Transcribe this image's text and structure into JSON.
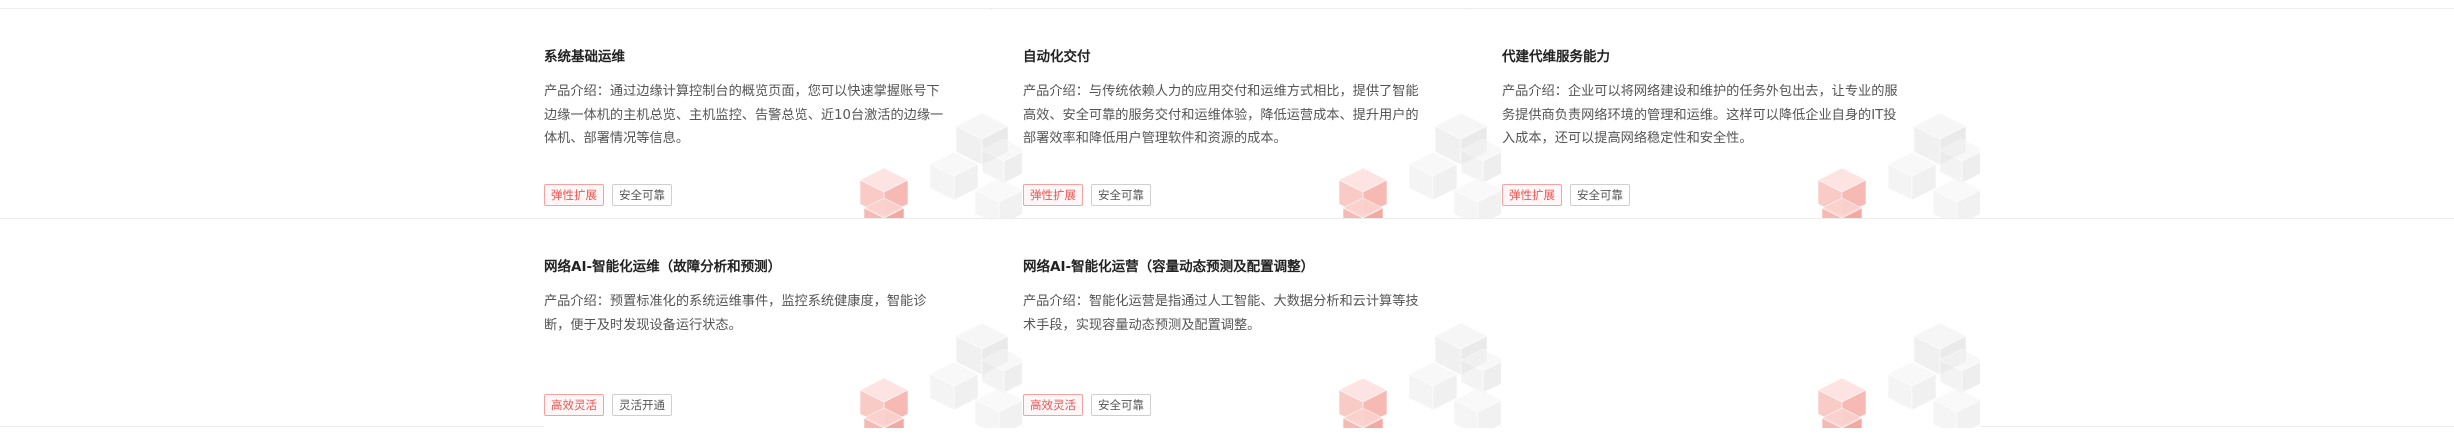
{
  "cards": [
    {
      "title": "系统基础运维",
      "desc": "产品介绍：通过边缘计算控制台的概览页面，您可以快速掌握账号下边缘一体机的主机总览、主机监控、告警总览、近10台激活的边缘一体机、部署情况等信息。",
      "tags": [
        "弹性扩展",
        "安全可靠"
      ]
    },
    {
      "title": "自动化交付",
      "desc": "产品介绍：与传统依赖人力的应用交付和运维方式相比，提供了智能高效、安全可靠的服务交付和运维体验，降低运营成本、提升用户的部署效率和降低用户管理软件和资源的成本。",
      "tags": [
        "弹性扩展",
        "安全可靠"
      ]
    },
    {
      "title": "代建代维服务能力",
      "desc": "产品介绍：企业可以将网络建设和维护的任务外包出去，让专业的服务提供商负责网络环境的管理和运维。这样可以降低企业自身的IT投入成本，还可以提高网络稳定性和安全性。",
      "tags": [
        "弹性扩展",
        "安全可靠"
      ]
    },
    {
      "title": "网络AI-智能化运维（故障分析和预测）",
      "desc": "产品介绍：预置标准化的系统运维事件，监控系统健康度，智能诊断，便于及时发现设备运行状态。",
      "tags": [
        "高效灵活",
        "灵活开通"
      ]
    },
    {
      "title": "网络AI-智能化运营（容量动态预测及配置调整）",
      "desc": "产品介绍：智能化运营是指通过人工智能、大数据分析和云计算等技术手段，实现容量动态预测及配置调整。",
      "tags": [
        "高效灵活",
        "安全可靠"
      ]
    },
    {
      "title": "",
      "desc": "",
      "tags": []
    }
  ],
  "colors": {
    "accent_red": "#f0524f",
    "divider": "#ececec",
    "title": "#222222",
    "text": "#555555"
  },
  "icons": [
    "cube-decoration-icon"
  ]
}
